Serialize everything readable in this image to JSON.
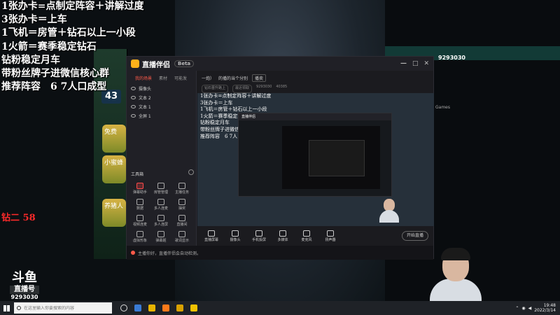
{
  "overlay": {
    "lines": [
      "1张办卡=点制定阵容＋讲解过度",
      "3张办卡＝上车",
      "1飞机＝房管＋钻石以上一小段",
      "1火箭＝赛季稳定钻石",
      "钻粉稳定月车",
      "带粉丝牌子进微信核心群",
      "推荐阵容　6 7人口成型"
    ],
    "diamond_label": "钻二 58"
  },
  "douyu": {
    "logo": "斗鱼",
    "sub": "直播号",
    "room": "9293030"
  },
  "game": {
    "level": "43",
    "card1": "免费",
    "card2": "小蜜蜂",
    "card3": "养猪人"
  },
  "app": {
    "title": "直播伴侣",
    "beta": "Beta",
    "left_tabs": [
      "我的场景",
      "素材",
      "可能发"
    ],
    "scenes": [
      "摄像头",
      "文本 2",
      "文本 1",
      "全屏 1"
    ],
    "tools_title": "工具箱",
    "tools": [
      "弹幕助手",
      "房管管理",
      "主播任务",
      "数据",
      "多人连麦",
      "抽奖",
      "视频连麦",
      "多人连屏",
      "直播间",
      "虚拟形象",
      "弹幕姬",
      "歌词显示"
    ],
    "topbar": [
      "一炮）",
      "的播的当个分别",
      "播卖"
    ],
    "subbar": [
      "钻石晋升路上",
      "最近领取",
      "9293030",
      "40385"
    ],
    "preview_lines": [
      "1张办卡=点制定阵容＋讲解过度",
      "3张办卡＝上车",
      "1飞机＝房管＋钻石以上一小段",
      "1火箭＝赛季稳定钻石",
      "钻粉稳定月车",
      "带粉丝牌子进微信核心群",
      "推荐阵容　6 7人口成型"
    ],
    "nested_title": "直播伴侣",
    "controls": [
      "直播屏幕",
      "摄像头",
      "手机投屏",
      "多媒体",
      "麦克风",
      "扬声器"
    ],
    "start_button": "开始直播",
    "notice": "主播你好，直播伴侣会自动检测。"
  },
  "right": {
    "id": "9293030",
    "games": "Games"
  },
  "taskbar": {
    "search_placeholder": "在这里输入你要搜索的内容",
    "time": "19:48",
    "date": "2022/3/14"
  }
}
